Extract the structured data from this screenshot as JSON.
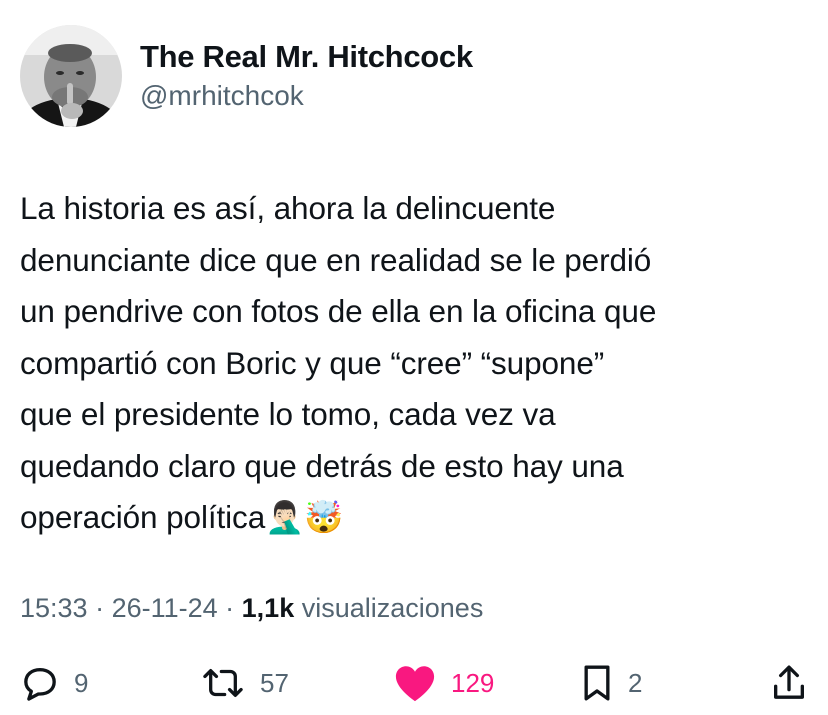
{
  "user": {
    "display_name": "The Real Mr. Hitchcock",
    "handle": "@mrhitchcok",
    "avatar_icon": "profile-photo"
  },
  "tweet": {
    "lines": [
      "La historia es así, ahora la delincuente",
      "denunciante dice que en realidad se le perdió",
      "un pendrive con fotos de ella en la oficina que",
      "compartió con Boric y que “cree” “supone”",
      "que el presidente lo tomo, cada vez va",
      "quedando claro que detrás de esto hay una",
      "operación política"
    ],
    "emojis": "🤦🏻‍♂️🤯"
  },
  "meta": {
    "time": "15:33",
    "separator": " · ",
    "date": "26-11-24",
    "views_count": "1,1k",
    "views_label": "visualizaciones"
  },
  "actions": {
    "replies": "9",
    "retweets": "57",
    "likes": "129",
    "bookmarks": "2",
    "icons": [
      "reply-icon",
      "retweet-icon",
      "heart-icon",
      "bookmark-icon",
      "share-icon"
    ],
    "colors": {
      "muted": "#536471",
      "like": "#f91880",
      "text": "#0f1419"
    }
  }
}
